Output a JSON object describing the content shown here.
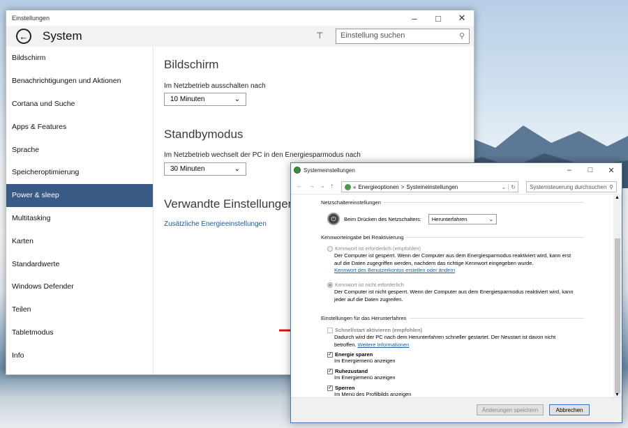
{
  "settings": {
    "window_title": "Einstellungen",
    "header_title": "System",
    "search_placeholder": "Einstellung suchen",
    "sidebar": [
      {
        "label": "Bildschirm"
      },
      {
        "label": "Benachrichtigungen und Aktionen"
      },
      {
        "label": "Cortana und Suche"
      },
      {
        "label": "Apps & Features"
      },
      {
        "label": "Sprache"
      },
      {
        "label": "Speicheroptimierung"
      },
      {
        "label": "Power & sleep"
      },
      {
        "label": "Multitasking"
      },
      {
        "label": "Karten"
      },
      {
        "label": "Standardwerte"
      },
      {
        "label": "Windows Defender"
      },
      {
        "label": "Teilen"
      },
      {
        "label": "Tabletmodus"
      },
      {
        "label": "Info"
      }
    ],
    "active_item": "Power & sleep",
    "screen_heading": "Bildschirm",
    "screen_label": "Im Netzbetrieb ausschalten nach",
    "screen_value": "10 Minuten",
    "standby_heading": "Standbymodus",
    "standby_label": "Im Netzbetrieb wechselt der PC in den Energiesparmodus nach",
    "standby_value": "30 Minuten",
    "related_heading": "Verwandte Einstellungen",
    "related_link": "Zusätzliche Energieeinstellungen"
  },
  "cp": {
    "window_title": "Systemeinstellungen",
    "breadcrumb_prefix": "«",
    "breadcrumb_1": "Energieoptionen",
    "breadcrumb_sep": ">",
    "breadcrumb_2": "Systemeinstellungen",
    "search_placeholder": "Systemsteuerung durchsuchen",
    "section_power_button": "Netzschaltereinstellungen",
    "power_button_label": "Beim Drücken des Netzschalters:",
    "power_button_value": "Herunterfahren",
    "section_password": "Kennworteingabe bei Reaktivierung",
    "pw_required_label": "Kennwort ist erforderlich (empfohlen)",
    "pw_required_desc": "Der Computer ist gesperrt. Wenn der Computer aus dem Energiesparmodus reaktiviert wird, kann erst auf die Daten zugegriffen werden, nachdem das richtige Kennwort eingegeben wurde.",
    "pw_required_link": "Kennwort des Benutzerkontos erstellen oder ändern",
    "pw_not_required_label": "Kennwort ist nicht erforderlich",
    "pw_not_required_desc": "Der Computer ist nicht gesperrt. Wenn der Computer aus dem Energiesparmodus reaktiviert wird, kann jeder auf die Daten zugreifen.",
    "section_shutdown": "Einstellungen für das Herunterfahren",
    "fast_startup_label": "Schnellstart aktivieren (empfohlen)",
    "fast_startup_desc": "Dadurch wird der PC nach dem Herunterfahren schneller gestartet. Der Neustart ist davon nicht betroffen.",
    "fast_startup_link": "Weitere Informationen",
    "sleep_label": "Energie sparen",
    "sleep_desc": "Im Energiemenü anzeigen",
    "hibernate_label": "Ruhezustand",
    "hibernate_desc": "Im Energiemenü anzeigen",
    "lock_label": "Sperren",
    "lock_desc": "Im Menü des Profilbilds anzeigen",
    "save_button": "Änderungen speichern",
    "cancel_button": "Abbrechen"
  },
  "colors": {
    "accent": "#3a5a86",
    "link": "#1a5ea6",
    "arrow": "#e01010"
  }
}
